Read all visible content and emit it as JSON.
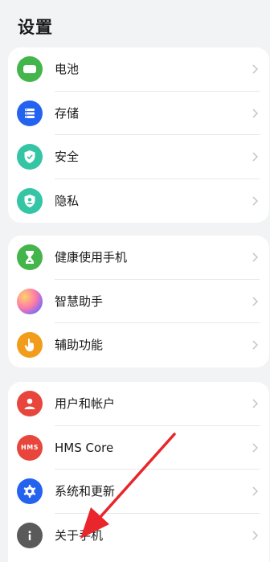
{
  "page": {
    "title": "设置"
  },
  "groups": [
    {
      "items": [
        {
          "label": "电池",
          "icon": "battery-icon",
          "color": "#43b54a"
        },
        {
          "label": "存储",
          "icon": "storage-icon",
          "color": "#2463f0"
        },
        {
          "label": "安全",
          "icon": "shield-icon",
          "color": "#34c5a5"
        },
        {
          "label": "隐私",
          "icon": "privacy-icon",
          "color": "#34c5a5"
        }
      ]
    },
    {
      "items": [
        {
          "label": "健康使用手机",
          "icon": "hourglass-icon",
          "color": "#43b54a"
        },
        {
          "label": "智慧助手",
          "icon": "smart-assistant-icon",
          "color": "#b86ad8"
        },
        {
          "label": "辅助功能",
          "icon": "hand-icon",
          "color": "#f29c1c"
        }
      ]
    },
    {
      "items": [
        {
          "label": "用户和帐户",
          "icon": "user-icon",
          "color": "#e8453c"
        },
        {
          "label": "HMS Core",
          "icon": "hms-icon",
          "icon_text": "HMS",
          "color": "#e8453c"
        },
        {
          "label": "系统和更新",
          "icon": "gear-icon",
          "color": "#2463f0"
        },
        {
          "label": "关于手机",
          "icon": "info-icon",
          "color": "#5a5a5a"
        }
      ]
    }
  ],
  "annotation": {
    "arrow_color": "#e8262b"
  }
}
